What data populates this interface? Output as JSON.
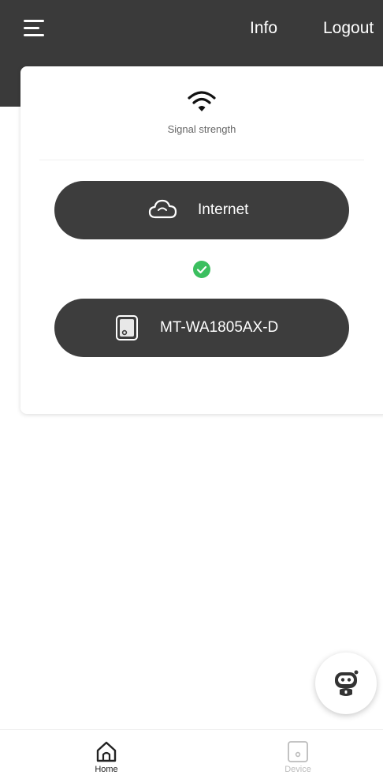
{
  "header": {
    "info_label": "Info",
    "logout_label": "Logout"
  },
  "card": {
    "signal_label": "Signal strength",
    "internet_label": "Internet",
    "device_label": "MT-WA1805AX-D",
    "status": "connected"
  },
  "bottom_nav": {
    "items": [
      {
        "label": "Home",
        "icon": "home-icon",
        "active": true
      },
      {
        "label": "Device",
        "icon": "device-icon",
        "active": false
      }
    ]
  },
  "colors": {
    "header_bg": "#3a3a3a",
    "pill_bg": "#3d3d3d",
    "status_ok": "#3bbf5f",
    "nav_active": "#222222",
    "nav_inactive": "#bcbcbc"
  },
  "icons": {
    "menu": "menu-icon",
    "signal": "wifi-signal-icon",
    "internet": "cloud-icon",
    "device": "router-device-icon",
    "status": "check-circle-icon",
    "assistant": "robot-assistant-icon"
  }
}
